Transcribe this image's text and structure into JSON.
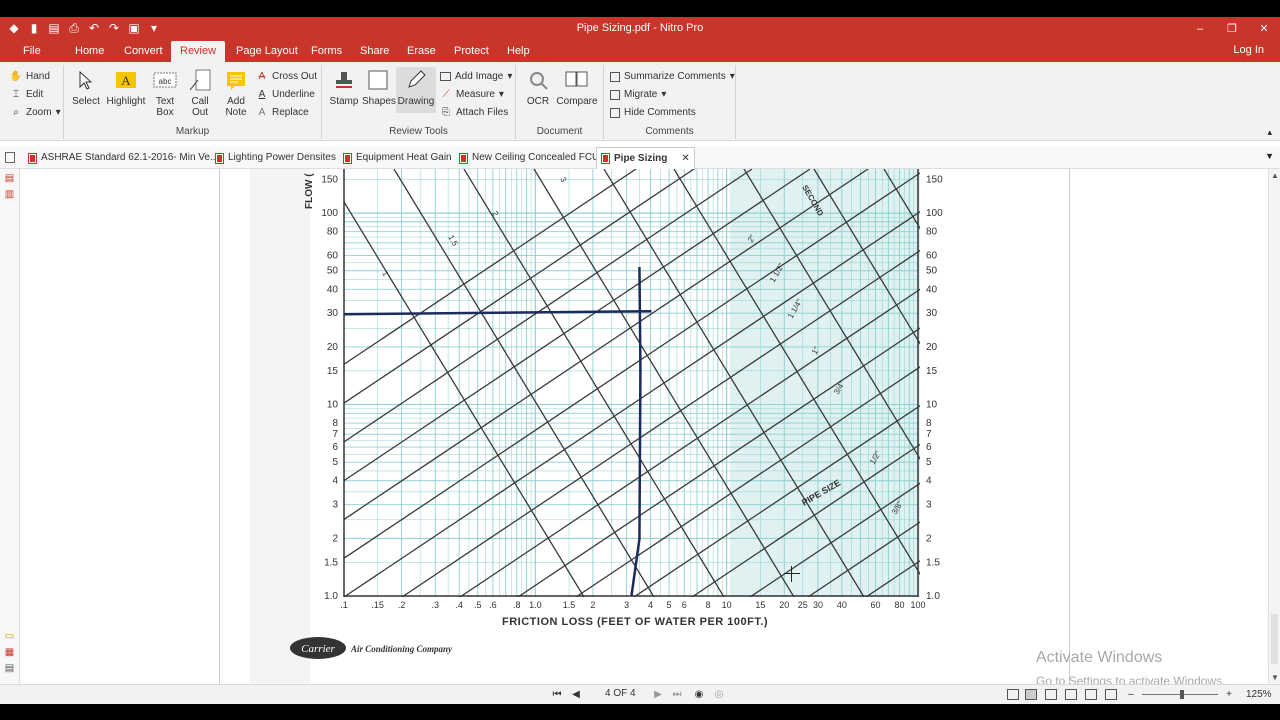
{
  "window": {
    "title": "Pipe Sizing.pdf - Nitro Pro",
    "controls": [
      "–",
      "❐",
      "✕"
    ]
  },
  "quick_access": [
    "▮",
    "▤",
    "⎙",
    "↶",
    "↷",
    "▣",
    "▾"
  ],
  "menu": {
    "tabs": [
      "File",
      "Home",
      "Convert",
      "Review",
      "Page Layout",
      "Forms",
      "Share",
      "Erase",
      "Protect",
      "Help"
    ],
    "active": "Review",
    "login": "Log In"
  },
  "ribbon": {
    "nav": {
      "hand": "Hand",
      "edit": "Edit",
      "zoom": "Zoom"
    },
    "markup": {
      "label": "Markup",
      "select": "Select",
      "highlight": "Highlight",
      "textbox": "Text Box",
      "callout": "Call Out",
      "addnote": "Add Note",
      "crossout": "Cross Out",
      "underline": "Underline",
      "replace": "Replace"
    },
    "review_tools": {
      "label": "Review Tools",
      "stamp": "Stamp",
      "shapes": "Shapes",
      "drawing": "Drawing",
      "add_image": "Add Image",
      "measure": "Measure",
      "attach_files": "Attach Files"
    },
    "document": {
      "label": "Document",
      "ocr": "OCR",
      "compare": "Compare"
    },
    "comments": {
      "label": "Comments",
      "summarize": "Summarize Comments",
      "migrate": "Migrate",
      "hide": "Hide Comments"
    }
  },
  "doc_tabs": [
    "ASHRAE Standard 62.1-2016- Min Ve...",
    "Lighting Power Densites",
    "Equipment Heat Gain",
    "New Ceiling Concealed FCU",
    "Pipe Sizing"
  ],
  "active_doc_tab": "Pipe Sizing",
  "chart": {
    "y_axis_label": "FLOW (",
    "y_ticks": [
      "150",
      "100",
      "80",
      "60",
      "50",
      "40",
      "30",
      "20",
      "15",
      "10",
      "8",
      "7",
      "6",
      "5",
      "4",
      "3",
      "2",
      "1.5",
      "1.0"
    ],
    "y_ticks_right": [
      "150",
      "100",
      "80",
      "60",
      "50",
      "40",
      "30",
      "20",
      "15",
      "10",
      "8",
      "7",
      "6",
      "5",
      "4",
      "3",
      "2",
      "1.5",
      "1.0"
    ],
    "x_ticks": [
      ".1",
      ".15",
      ".2",
      ".3",
      ".4",
      ".5",
      ".6",
      ".8",
      "1.0",
      "1.5",
      "2",
      "3",
      "4",
      "5",
      "6",
      "8",
      "10",
      "15",
      "20",
      "25",
      "30",
      "40",
      "60",
      "80",
      "100"
    ],
    "x_axis_label": "FRICTION LOSS (FEET OF WATER PER 100FT.)",
    "velocity_labels": [
      "3",
      "2",
      "1.5",
      "1"
    ],
    "pipe_size_labels": [
      "2\"",
      "1 1/2\"",
      "1 1/4\"",
      "1\"",
      "3/4\"",
      "1/2\"",
      "3/8\""
    ],
    "pipe_size_title": "PIPE SIZE",
    "seconds_label": "SECOND",
    "reading": {
      "flow": 30,
      "friction_loss": 3.5
    },
    "brand": "Carrier",
    "brand_tagline": "Air Conditioning Company"
  },
  "watermark": {
    "line1": "Activate Windows",
    "line2": "Go to Settings to activate Windows."
  },
  "status": {
    "page_indicator": "4 OF 4",
    "zoom": "125%"
  }
}
